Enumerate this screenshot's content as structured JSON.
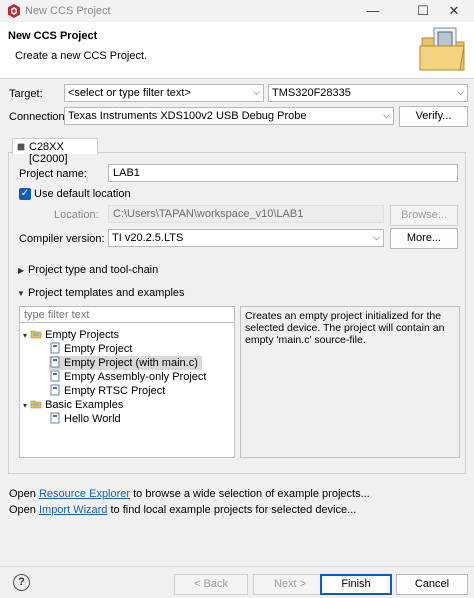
{
  "window": {
    "title": "New CCS Project",
    "minimize": "—",
    "maximize": "☐",
    "close": "✕"
  },
  "header": {
    "title": "New CCS Project",
    "description": "Create a new CCS Project."
  },
  "target": {
    "label": "Target:",
    "filter_value": "<select or type filter text>",
    "device_value": "TMS320F28335"
  },
  "connection": {
    "label": "Connection:",
    "value": "Texas Instruments XDS100v2 USB Debug Probe",
    "verify_label": "Verify..."
  },
  "tab": {
    "label": "C28XX [C2000]"
  },
  "project": {
    "name_label": "Project name:",
    "name_value": "LAB1",
    "use_default_label": "Use default location",
    "location_label": "Location:",
    "location_value": "C:\\Users\\TAPAN\\workspace_v10\\LAB1",
    "browse_label": "Browse...",
    "compiler_label": "Compiler version:",
    "compiler_value": "TI v20.2.5.LTS",
    "more_label": "More..."
  },
  "sections": {
    "project_type": "Project type and tool-chain",
    "templates": "Project templates and examples"
  },
  "templates": {
    "filter_placeholder": "type filter text",
    "groups": [
      {
        "label": "Empty Projects",
        "items": [
          "Empty Project",
          "Empty Project (with main.c)",
          "Empty Assembly-only Project",
          "Empty RTSC Project"
        ]
      },
      {
        "label": "Basic Examples",
        "items": [
          "Hello World"
        ]
      }
    ],
    "description": "Creates an empty project initialized for the selected device. The project will contain an empty 'main.c' source-file."
  },
  "open_lines": {
    "line1_prefix": "Open ",
    "line1_link": "Resource Explorer",
    "line1_suffix": " to browse a wide selection of example projects...",
    "line2_prefix": "Open ",
    "line2_link": "Import Wizard",
    "line2_suffix": " to find local example projects for selected device..."
  },
  "footer": {
    "help": "?",
    "back_label": "< Back",
    "next_label": "Next >",
    "finish_label": "Finish",
    "cancel_label": "Cancel"
  }
}
